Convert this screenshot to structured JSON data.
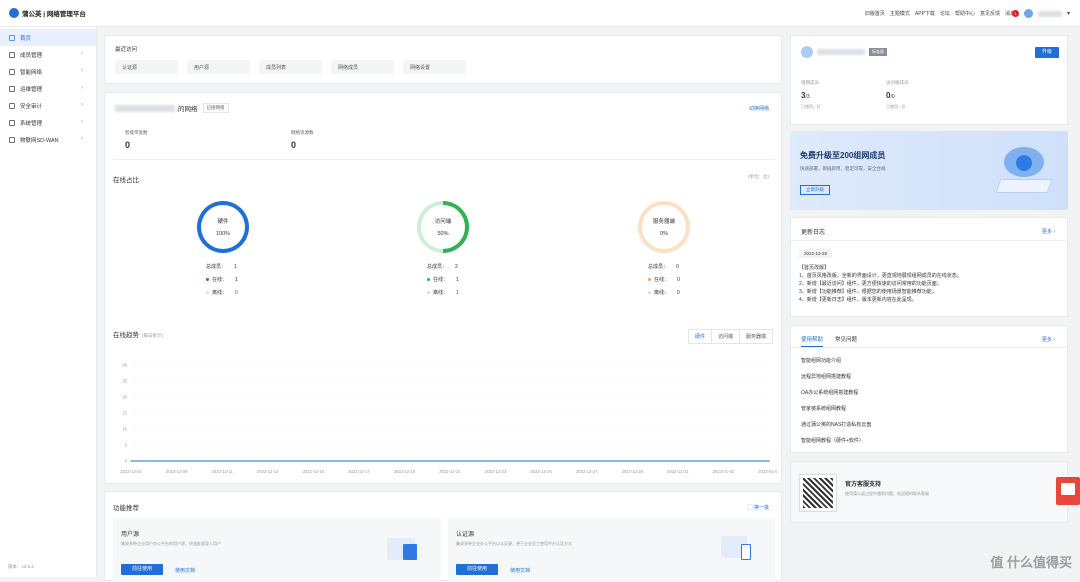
{
  "app": {
    "logo_text": "蒲公英 | 网络管理平台",
    "version": "版本：v2.6.4"
  },
  "topnav": {
    "items": [
      "旧版首页",
      "主题模式",
      "APP下载",
      "论坛",
      "帮助中心",
      "意见反馈",
      "消息"
    ],
    "message_count": "1"
  },
  "sidebar": {
    "items": [
      {
        "label": "首页",
        "icon": "home-icon",
        "active": true,
        "chevron": false
      },
      {
        "label": "成员管理",
        "icon": "users-icon",
        "chevron": true
      },
      {
        "label": "智能网络",
        "icon": "network-icon",
        "chevron": true
      },
      {
        "label": "运维管理",
        "icon": "ops-icon",
        "chevron": true
      },
      {
        "label": "安全审计",
        "icon": "shield-icon",
        "chevron": true
      },
      {
        "label": "系统管理",
        "icon": "settings-icon",
        "chevron": true
      },
      {
        "label": "物联网SD-WAN",
        "icon": "iot-icon",
        "chevron": true
      }
    ]
  },
  "recent": {
    "title": "最近访问",
    "items": [
      "认证源",
      "用户源",
      "成员列表",
      "网络成员",
      "网络设置"
    ]
  },
  "network": {
    "name_suffix": "的网络",
    "tag": "已接网络",
    "switch_label": "切换网络",
    "stats": [
      {
        "label": "智能带宽数",
        "value": "0"
      },
      {
        "label": "网络资源数",
        "value": "0"
      }
    ]
  },
  "online": {
    "title": "在线占比",
    "unit": "(单位：台)",
    "rings": [
      {
        "name": "硬件",
        "pct": "100%",
        "fraction": 1.0,
        "color": "#1f6fd8",
        "total_label": "总成员：",
        "total": "1",
        "online_label": "在线：",
        "online": "1",
        "offline_label": "离线：",
        "offline": "0",
        "dot": "#1f6fd8"
      },
      {
        "name": "访问端",
        "pct": "50%",
        "fraction": 0.5,
        "color": "#2eb34e",
        "total_label": "总成员：",
        "total": "2",
        "online_label": "在线：",
        "online": "1",
        "offline_label": "离线：",
        "offline": "1",
        "dot": "#2eb34e"
      },
      {
        "name": "服务器端",
        "pct": "0%",
        "fraction": 0.0,
        "color": "#f2a65a",
        "total_label": "总成员：",
        "total": "0",
        "online_label": "在线：",
        "online": "0",
        "offline_label": "离线：",
        "offline": "0",
        "dot": "#f2a65a"
      }
    ]
  },
  "trend": {
    "title": "在线趋势",
    "subtitle": "(每日统计)",
    "tabs": [
      "硬件",
      "访问端",
      "服务器端"
    ]
  },
  "chart_data": {
    "type": "line",
    "title": "",
    "x": [
      "2022-12-02",
      "2022-12-09",
      "2022-12-11",
      "2022-12-13",
      "2022-12-15",
      "2022-12-17",
      "2022-12-19",
      "2022-12-21",
      "2022-12-23",
      "2022-12-25",
      "2022-12-27",
      "2022-12-29",
      "2022-12-31",
      "2023-01-02",
      "2023-01-04"
    ],
    "series": [
      {
        "values": [
          0,
          0,
          0,
          0,
          0,
          0,
          0,
          0,
          0,
          0,
          0,
          0,
          0,
          0,
          0
        ]
      }
    ],
    "yticks": [
      "0",
      "5",
      "10",
      "15",
      "20",
      "25",
      "30"
    ],
    "ylim": [
      0,
      30
    ],
    "grid": true,
    "color": "#1f6fd8"
  },
  "features": {
    "title": "功能推荐",
    "refresh_label": "换一批",
    "cards": [
      {
        "name": "用户源",
        "desc": "集成多种企业用户办公平台的用户源，快速批量导入用户",
        "primary": "前往使用",
        "secondary": "使用文档"
      },
      {
        "name": "认证源",
        "desc": "集成多种企业办公平台以认证源，便于企业员工使用平台认证方式",
        "primary": "前往使用",
        "secondary": "使用文档"
      }
    ]
  },
  "account": {
    "tag": "标准版",
    "upgrade_label": "升级",
    "stats": [
      {
        "label": "组网成员",
        "value": "3",
        "total": "/3",
        "sub": "已使用 / 总"
      },
      {
        "label": "访问端成员",
        "value": "0",
        "total": "/0",
        "sub": "已使用 / 总"
      }
    ]
  },
  "promo": {
    "title": "免费升级至200组网成员",
    "subtitle": "快速部署，即插即用，稳定可靠，安全合规",
    "button": "立即升级"
  },
  "news": {
    "title": "更新日志",
    "more": "更多",
    "date": "2022-12-28",
    "heading": "【首页改版】",
    "lines": [
      "1、首页风格改版，全新的界面设计，更直观地展现组网成员的在线状态；",
      "2、新增【最近访问】组件，更方便快速的访问常用的功能页面；",
      "3、新增【功能推荐】组件，根据您的使用场景智能推荐功能；",
      "4、新增【更新日志】组件，版本更新内容在此呈现。"
    ]
  },
  "help": {
    "tabs": [
      "使用帮助",
      "常见问题"
    ],
    "more": "更多",
    "items": [
      "智能组网功能介绍",
      "远程异地组网搭建教程",
      "OA办公系统组网搭建教程",
      "管家婆系统组网教程",
      "通过蒲公英的NAS打造私有云盘",
      "智能组网教程（硬件+软件）"
    ]
  },
  "service": {
    "title": "官方客服支持",
    "desc": "使用蒲公英过程中遇到问题，欢迎随时联系客服"
  },
  "watermark": {
    "text": "值 什么值得买"
  }
}
